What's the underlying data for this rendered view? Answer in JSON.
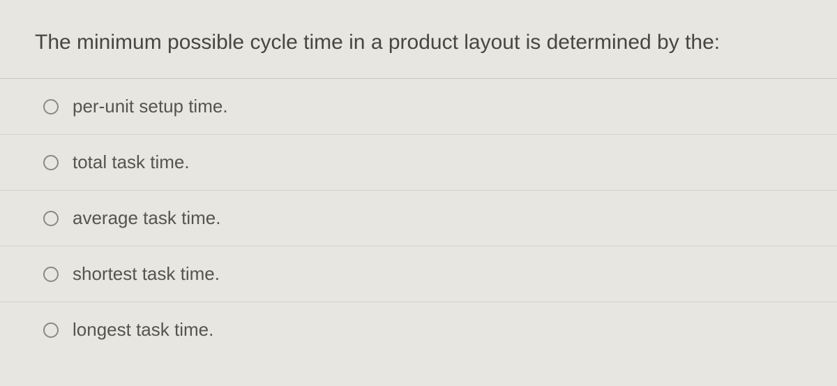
{
  "question": {
    "text": "The minimum possible cycle time in a product layout is determined by the:"
  },
  "options": [
    {
      "label": "per-unit setup time."
    },
    {
      "label": "total task time."
    },
    {
      "label": "average task time."
    },
    {
      "label": "shortest task time."
    },
    {
      "label": "longest task time."
    }
  ]
}
